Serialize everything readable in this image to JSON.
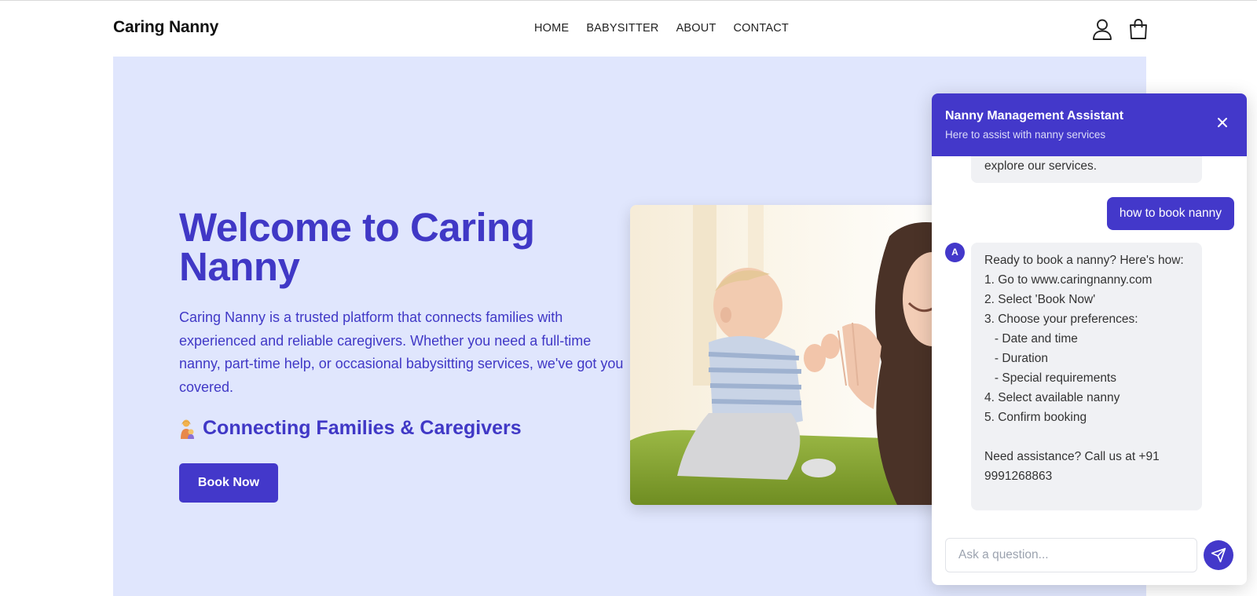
{
  "header": {
    "logo": "Caring Nanny",
    "nav": [
      "HOME",
      "BABYSITTER",
      "ABOUT",
      "CONTACT"
    ],
    "icons": [
      "user-icon",
      "shopping-bag-icon"
    ]
  },
  "hero": {
    "title": "Welcome to Caring Nanny",
    "description": "Caring Nanny is a trusted platform that connects families with experienced and reliable caregivers. Whether you need a full-time nanny, part-time help, or occasional babysitting services, we've got you covered.",
    "subheading": "Connecting Families & Caregivers",
    "subheading_icon": "mother-child-emoji-icon",
    "book_button": "Book Now",
    "image_icon": "baby-and-mother-photo"
  },
  "chat": {
    "title": "Nanny Management Assistant",
    "subtitle": "Here to assist with nanny services",
    "previous_bot_tail": "explore our services.",
    "user_message": "how to book nanny",
    "bot_avatar": "A",
    "bot_reply": "Ready to book a nanny? Here's how:\n1. Go to www.caringnanny.com\n2. Select 'Book Now'\n3. Choose your preferences:\n   - Date and time\n   - Duration\n   - Special requirements\n4. Select available nanny\n5. Confirm booking\n\nNeed assistance? Call us at +91 9991268863",
    "input_placeholder": "Ask a question...",
    "colors": {
      "accent": "#4338ca",
      "bubble": "#f0f1f4"
    }
  },
  "colors": {
    "brand": "#4338ca",
    "hero_bg": "#e0e6fd",
    "hero_text": "#4038c6"
  }
}
